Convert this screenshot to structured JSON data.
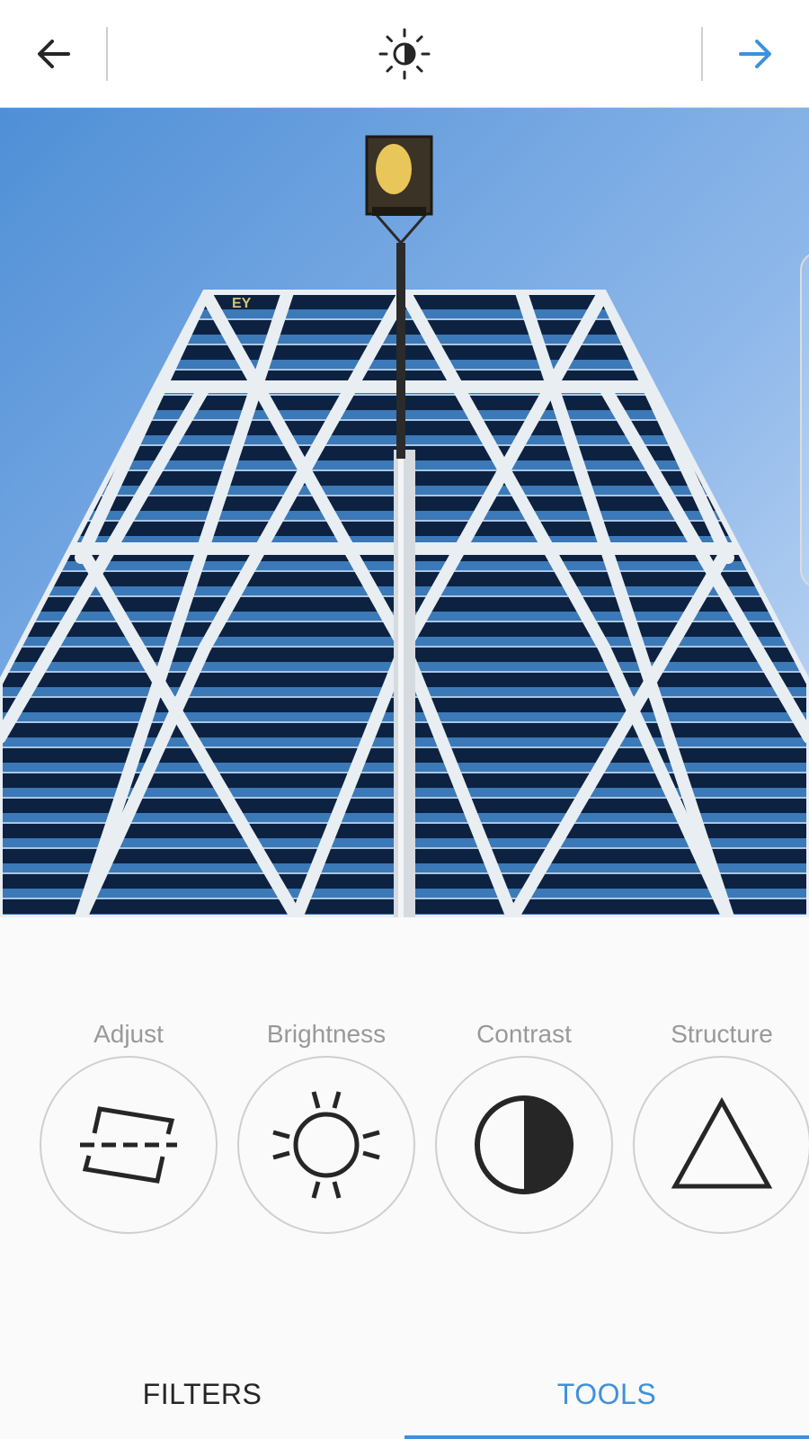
{
  "header": {
    "back_icon": "arrow-left-icon",
    "center_icon": "lux-brightness-icon",
    "next_icon": "arrow-right-icon",
    "accent_color": "#3f90dc"
  },
  "photo": {
    "subject": "low-angle view of diagrid glass office tower with street lamp",
    "sign_text": "EY"
  },
  "tools": [
    {
      "label": "Adjust",
      "icon": "adjust-icon"
    },
    {
      "label": "Brightness",
      "icon": "brightness-icon"
    },
    {
      "label": "Contrast",
      "icon": "contrast-icon"
    },
    {
      "label": "Structure",
      "icon": "structure-icon"
    }
  ],
  "tabs": {
    "filters": "FILTERS",
    "tools": "TOOLS",
    "active": "tools"
  }
}
